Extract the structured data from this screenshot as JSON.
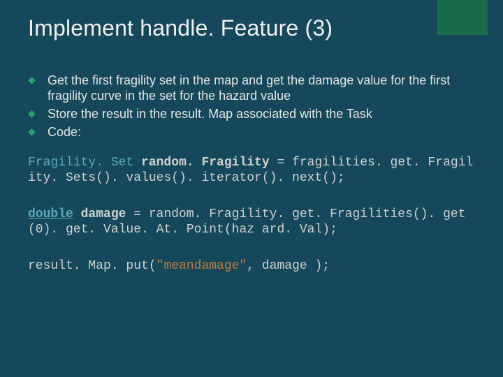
{
  "title": "Implement handle. Feature (3)",
  "bullets": [
    "Get the first fragility set in the map and get the damage value for the first fragility curve in the set for the hazard value",
    "Store the result in the result. Map associated with the Task",
    "Code:"
  ],
  "code1": {
    "type": "Fragility. Set ",
    "var": "random. Fragility",
    "eq": " = ",
    "expr": "fragilities. get. Fragility. Sets(). values(). iterator(). next();"
  },
  "code2": {
    "kw": "double",
    "sp": " ",
    "var": "damage",
    "eq": " = ",
    "expr": "random. Fragility. get. Fragilities(). get(0). get. Value. At. Point(haz ard. Val);"
  },
  "code3": {
    "pre": "result. Map. put(",
    "str": "\"meandamage\"",
    "post": ", damage );"
  }
}
